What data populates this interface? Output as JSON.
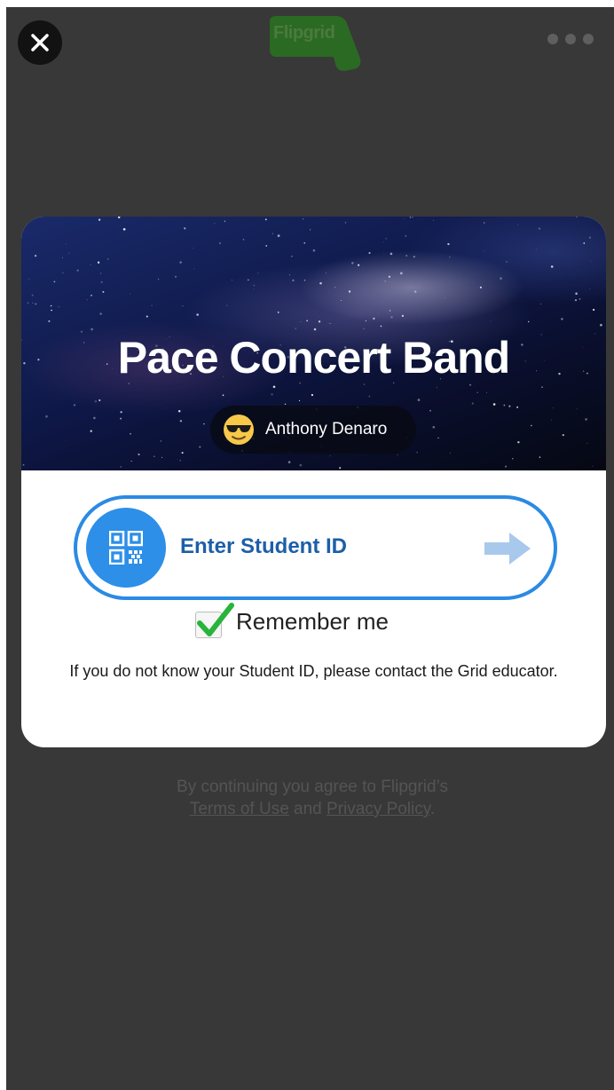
{
  "header": {
    "close_icon": "close-icon",
    "logo_text": "Flipgrid",
    "more_icon": "more-horizontal-icon"
  },
  "grid": {
    "title": "Pace Concert Band",
    "owner_name": "Anthony Denaro",
    "owner_avatar": "sunglasses-emoji-icon"
  },
  "student_id": {
    "label": "Enter Student ID",
    "qr_icon": "qr-code-icon",
    "submit_icon": "arrow-right-icon"
  },
  "remember": {
    "label": "Remember me",
    "checked": true
  },
  "help_text": "If you do not know your Student ID, please contact the Grid educator.",
  "legal": {
    "prefix": "By continuing you agree to Flipgrid’s",
    "terms_label": "Terms of Use",
    "joiner": "and",
    "privacy_label": "Privacy Policy",
    "suffix": "."
  },
  "colors": {
    "background": "#383838",
    "accent_blue": "#2b8ae4",
    "label_blue": "#1c5fa8",
    "check_green": "#27b43b",
    "logo_green": "#2b6a22"
  }
}
